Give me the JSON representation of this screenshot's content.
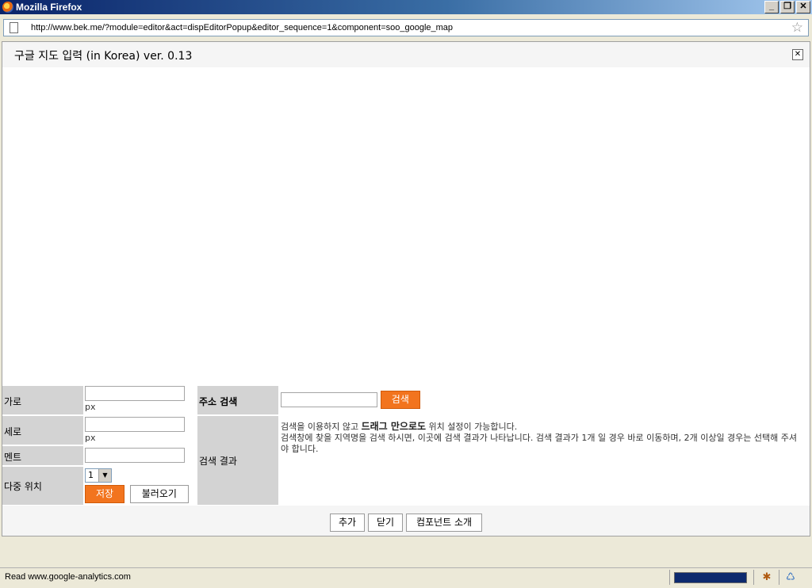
{
  "window": {
    "title": "Mozilla Firefox",
    "minimize": "_",
    "restore": "❐",
    "close": "✕"
  },
  "address": {
    "url": "http://www.bek.me/?module=editor&act=dispEditorPopup&editor_sequence=1&component=soo_google_map",
    "star": "☆"
  },
  "popup": {
    "title": "구글 지도 입력 (in Korea) ver. 0.13",
    "close": "✕"
  },
  "form": {
    "width_label": "가로",
    "width_value": "",
    "width_unit": "px",
    "height_label": "세로",
    "height_value": "",
    "height_unit": "px",
    "comment_label": "멘트",
    "comment_value": "",
    "multi_label": "다중 위치",
    "multi_selected": "1",
    "save_label": "저장",
    "load_label": "불러오기"
  },
  "search": {
    "label": "주소 검색",
    "value": "",
    "button": "검색",
    "results_label": "검색 결과",
    "msg_pre": "검색을 이용하지 않고 ",
    "msg_bold": "드래그 만으로도",
    "msg_post": " 위치 설정이 가능합니다.",
    "msg_line2": "검색창에 찾을 지역명을 검색 하시면, 이곳에 검색 결과가 나타납니다. 검색 결과가 1개 일 경우 바로 이동하며, 2개 이상일 경우는 선택해 주셔야 합니다."
  },
  "footer": {
    "add": "추가",
    "close": "닫기",
    "about": "컴포넌트 소개"
  },
  "status": {
    "text": "Read www.google-analytics.com"
  },
  "colors": {
    "accent": "#f2741e",
    "label_bg": "#d3d3d3",
    "titlebar": "#0a246a"
  }
}
